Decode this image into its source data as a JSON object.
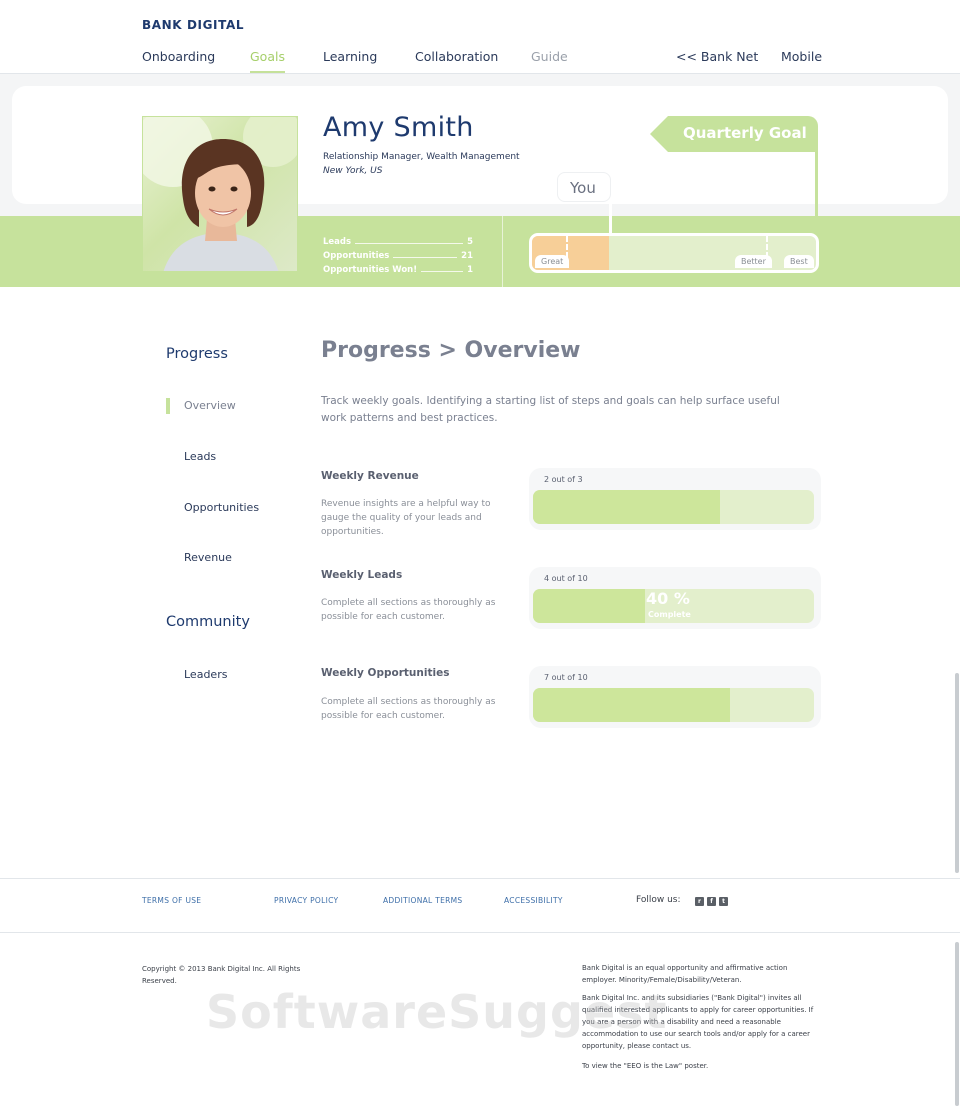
{
  "header": {
    "brand": "BANK DIGITAL",
    "nav": [
      {
        "label": "Onboarding"
      },
      {
        "label": "Goals"
      },
      {
        "label": "Learning"
      },
      {
        "label": "Collaboration"
      },
      {
        "label": "Guide"
      },
      {
        "label": "<< Bank Net"
      },
      {
        "label": "Mobile"
      }
    ]
  },
  "profile": {
    "name": "Amy Smith",
    "role": "Relationship Manager, Wealth Management",
    "location": "New York, US",
    "stats": [
      {
        "label": "Leads",
        "value": "5"
      },
      {
        "label": "Opportunities",
        "value": "21"
      },
      {
        "label": "Opportunities Won!",
        "value": "1"
      }
    ],
    "quarterly_goal_label": "Quarterly Goal",
    "you_label": "You",
    "meter_labels": {
      "great": "Great",
      "better": "Better",
      "best": "Best"
    },
    "meter_progress": 0.27
  },
  "sidebar": {
    "progress_heading": "Progress",
    "progress_items": [
      {
        "label": "Overview"
      },
      {
        "label": "Leads"
      },
      {
        "label": "Opportunities"
      },
      {
        "label": "Revenue"
      }
    ],
    "community_heading": "Community",
    "community_items": [
      {
        "label": "Leaders"
      }
    ]
  },
  "main": {
    "title": "Progress > Overview",
    "description": "Track weekly goals. Identifying a starting list of steps and goals can help surface useful work patterns and best practices.",
    "goals": [
      {
        "title": "Weekly Revenue",
        "description": "Revenue insights are a helpful way to gauge the quality of your leads and opportunities.",
        "count": "2 out of 3",
        "progress": 0.667
      },
      {
        "title": "Weekly Leads",
        "description": "Complete all sections as thoroughly as possible for each customer.",
        "count": "4 out of 10",
        "progress": 0.4,
        "percent_label": "40 %",
        "percent_sub": "Complete"
      },
      {
        "title": "Weekly Opportunities",
        "description": "Complete all sections as thoroughly as possible for each customer.",
        "count": "7 out of 10",
        "progress": 0.7
      }
    ]
  },
  "footer": {
    "links": [
      {
        "label": "TERMS OF USE"
      },
      {
        "label": "PRIVACY POLICY"
      },
      {
        "label": "ADDITIONAL TERMS"
      },
      {
        "label": "ACCESSIBILITY"
      }
    ],
    "follow_label": "Follow us:",
    "social": [
      {
        "icon": "rss-icon",
        "glyph": "r"
      },
      {
        "icon": "facebook-icon",
        "glyph": "f"
      },
      {
        "icon": "twitter-icon",
        "glyph": "t"
      }
    ],
    "copyright": "Copyright © 2013 Bank Digital Inc. All Rights Reserved.",
    "legal": [
      "Bank Digital is an equal opportunity and affirmative action employer. Minority/Female/Disability/Veteran.",
      "Bank Digital Inc. and its subsidiaries (\"Bank Digital\") invites all qualified interested applicants to apply for career opportunities. If you are a person with a disability and need a reasonable accommodation to use our search tools and/or apply for a career opportunity, please contact us.",
      "To view the \"EEO is the Law\" poster."
    ]
  },
  "watermark": "SoftwareSuggest",
  "colors": {
    "accent_green": "#c6e29c",
    "brand_navy": "#1e3a6e",
    "orange_fill": "#f7cf98",
    "link_blue": "#3d6ea8"
  }
}
